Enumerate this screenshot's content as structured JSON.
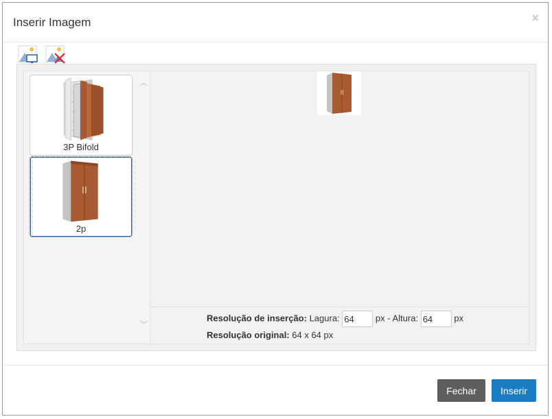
{
  "dialog": {
    "title": "Inserir Imagem",
    "close_glyph": "×"
  },
  "toolbar": {
    "icons": [
      "insert-image-icon",
      "remove-image-icon"
    ]
  },
  "images": [
    {
      "label": "3P Bifold",
      "selected": false
    },
    {
      "label": "2p",
      "selected": true
    }
  ],
  "scroll": {
    "up_glyph": "︿",
    "down_glyph": "﹀"
  },
  "resolution": {
    "insert_label": "Resolução de inserção:",
    "width_label": "Lagura:",
    "width_value": "64",
    "separator": "px - Altura:",
    "height_value": "64",
    "unit": "px",
    "original_label": "Resolução original:",
    "original_value": "64 x 64 px"
  },
  "footer": {
    "close_label": "Fechar",
    "insert_label": "Inserir"
  },
  "colors": {
    "primary": "#1a7dc1",
    "secondary": "#5e5e5e",
    "wood": "#a85a32"
  }
}
